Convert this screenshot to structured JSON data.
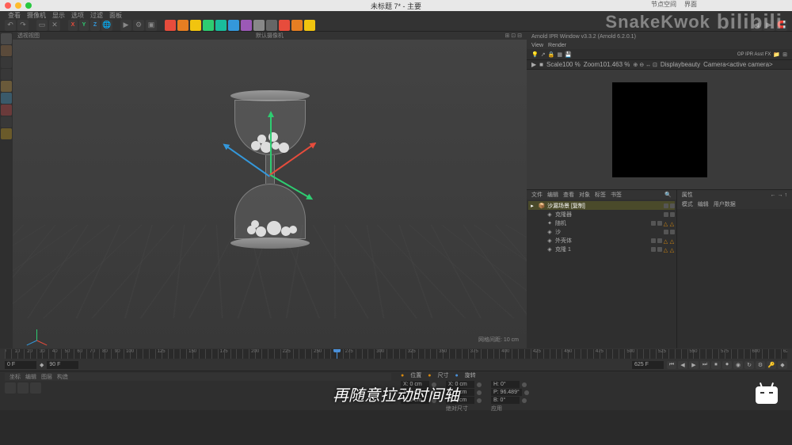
{
  "window": {
    "title": "未标题 7* - 主要",
    "top_tabs": [
      "节点空间",
      "界面"
    ]
  },
  "menubar": [
    "查看",
    "摄像机",
    "显示",
    "选项",
    "过滤",
    "面板"
  ],
  "toolbar": {
    "xyz": [
      "X",
      "Y",
      "Z"
    ],
    "color_icons": [
      "#e74c3c",
      "#e67e22",
      "#f1c40f",
      "#2ecc71",
      "#1abc9c",
      "#3498db",
      "#9b59b6",
      "#888",
      "#666",
      "#e74c3c",
      "#e67e22",
      "#f1c40f"
    ]
  },
  "viewport": {
    "header_left": "透视视图",
    "camera": "默认摄像机",
    "grid_label": "网格间距: 10 cm"
  },
  "arnold": {
    "title": "Arnold IPR Window v3.3.2 (Arnold 6.2.0.1)",
    "tabs": [
      "View",
      "Render"
    ],
    "op": "OP  IPR  Asst  FX",
    "scale_label": "Scale",
    "scale_val": "100 %",
    "zoom_label": "Zoom",
    "zoom_val": "101.463 %",
    "display_label": "Display",
    "display_val": "beauty",
    "camera_label": "Camera",
    "camera_val": "<active camera>"
  },
  "objects": {
    "tabs_left": [
      "文件",
      "编辑",
      "查看",
      "对象",
      "标签",
      "书签"
    ],
    "tabs_right": [
      "模式",
      "编辑",
      "用户数据"
    ],
    "attr_title": "属性",
    "tree": [
      {
        "name": "沙漏场景 [复制]",
        "indent": 0,
        "sel": true,
        "icon": "📦",
        "tags": 1
      },
      {
        "name": "克隆器",
        "indent": 1,
        "icon": "◈",
        "tags": 1
      },
      {
        "name": "随机",
        "indent": 1,
        "icon": "✦",
        "tags": 3
      },
      {
        "name": "沙",
        "indent": 1,
        "icon": "◈",
        "tags": 1
      },
      {
        "name": "外壳体",
        "indent": 1,
        "icon": "◈",
        "tags": 3
      },
      {
        "name": "克隆 1",
        "indent": 1,
        "icon": "◈",
        "tags": 3
      }
    ]
  },
  "timeline": {
    "start": 0,
    "end": 625,
    "cursor": 265,
    "start_field": "0 F",
    "end_field": "90 F",
    "tl_end_field": "625 F",
    "play_icons": [
      "⏮",
      "◀",
      "▶",
      "⏭",
      "⏹",
      "⏺",
      "◉",
      "↻",
      "⚙",
      "🔑",
      "◆"
    ]
  },
  "coords": {
    "tabs": [
      "位置",
      "尺寸",
      "旋转"
    ],
    "pos": {
      "x": "X: 0 cm",
      "y": "Y: 0 cm",
      "z": "Z: 0 cm"
    },
    "size": {
      "x": "X: 0 cm",
      "y": "Y: 0 cm",
      "z": "Z: 0 cm",
      "label": "绝对尺寸"
    },
    "rot": {
      "h": "H: 0°",
      "p": "P: 96.489°",
      "b": "B: 0°"
    },
    "apply": "应用"
  },
  "bottom_tabs": [
    "坐标",
    "编辑",
    "图层",
    "构造"
  ],
  "subtitle": "再随意拉动时间轴",
  "watermark": {
    "name": "SnakeKwok",
    "logo": "bilibili"
  }
}
